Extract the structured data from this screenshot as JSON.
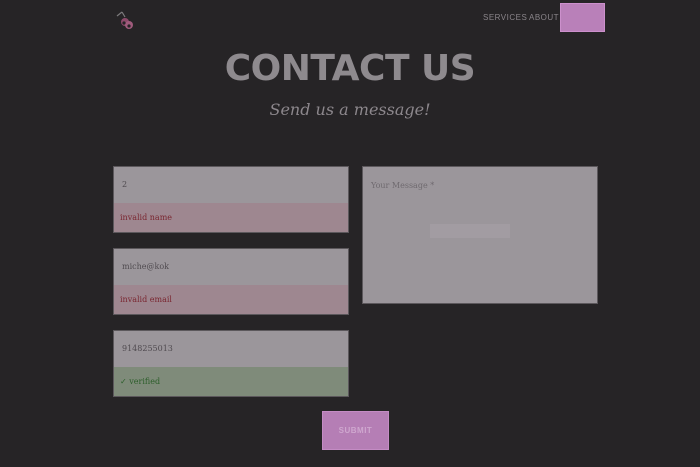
{
  "nav": {
    "services_label": "SERVICES",
    "about_label": "ABOUT",
    "cta_color": "#b980b9"
  },
  "header": {
    "title": "CONTACT US",
    "subtitle": "Send us a message!"
  },
  "form": {
    "name": {
      "value": "2",
      "status": "invalid name",
      "valid": false
    },
    "email": {
      "value": "miche@kok",
      "status": "invalid email",
      "valid": false
    },
    "phone": {
      "value": "9148255013",
      "status": "✓ verified",
      "valid": true
    },
    "message": {
      "placeholder": "Your Message *",
      "value": ""
    },
    "submit_label": "SUBMIT",
    "error_color": "#7a2630",
    "ok_color": "#2c5e2a"
  }
}
